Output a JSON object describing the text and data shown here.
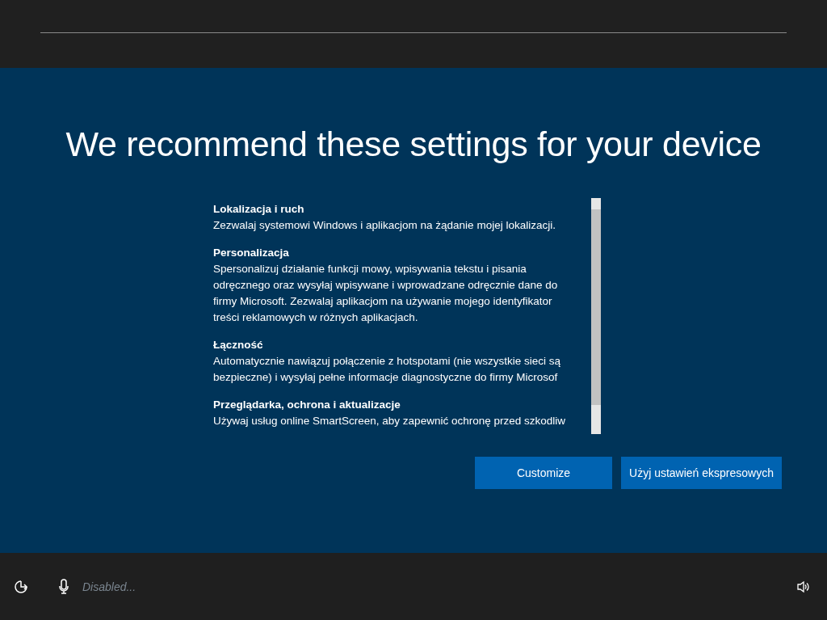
{
  "title": "We recommend these settings for your device",
  "settings": [
    {
      "heading": "Lokalizacja i ruch",
      "lines": [
        "Zezwalaj systemowi Windows i aplikacjom na żądanie mojej lokalizacji."
      ]
    },
    {
      "heading": "Personalizacja",
      "lines": [
        "Spersonalizuj działanie funkcji mowy, wpisywania tekstu i pisania",
        "odręcznego oraz wysyłaj wpisywane i wprowadzane odręcznie dane do",
        "firmy Microsoft. Zezwalaj aplikacjom na używanie mojego identyfikator",
        "treści reklamowych w różnych aplikacjach."
      ]
    },
    {
      "heading": "Łączność",
      "lines": [
        "Automatycznie nawiązuj połączenie z hotspotami (nie wszystkie sieci są",
        "bezpieczne) i wysyłaj pełne informacje diagnostyczne do firmy Microsof"
      ]
    },
    {
      "heading": "Przeglądarka, ochrona i aktualizacje",
      "lines": [
        "Używaj usług online SmartScreen, aby zapewnić ochronę przed szkodliw"
      ]
    }
  ],
  "buttons": [
    "Customize",
    "Użyj ustawień ekspresowych"
  ],
  "microphone_status": "Disabled..."
}
